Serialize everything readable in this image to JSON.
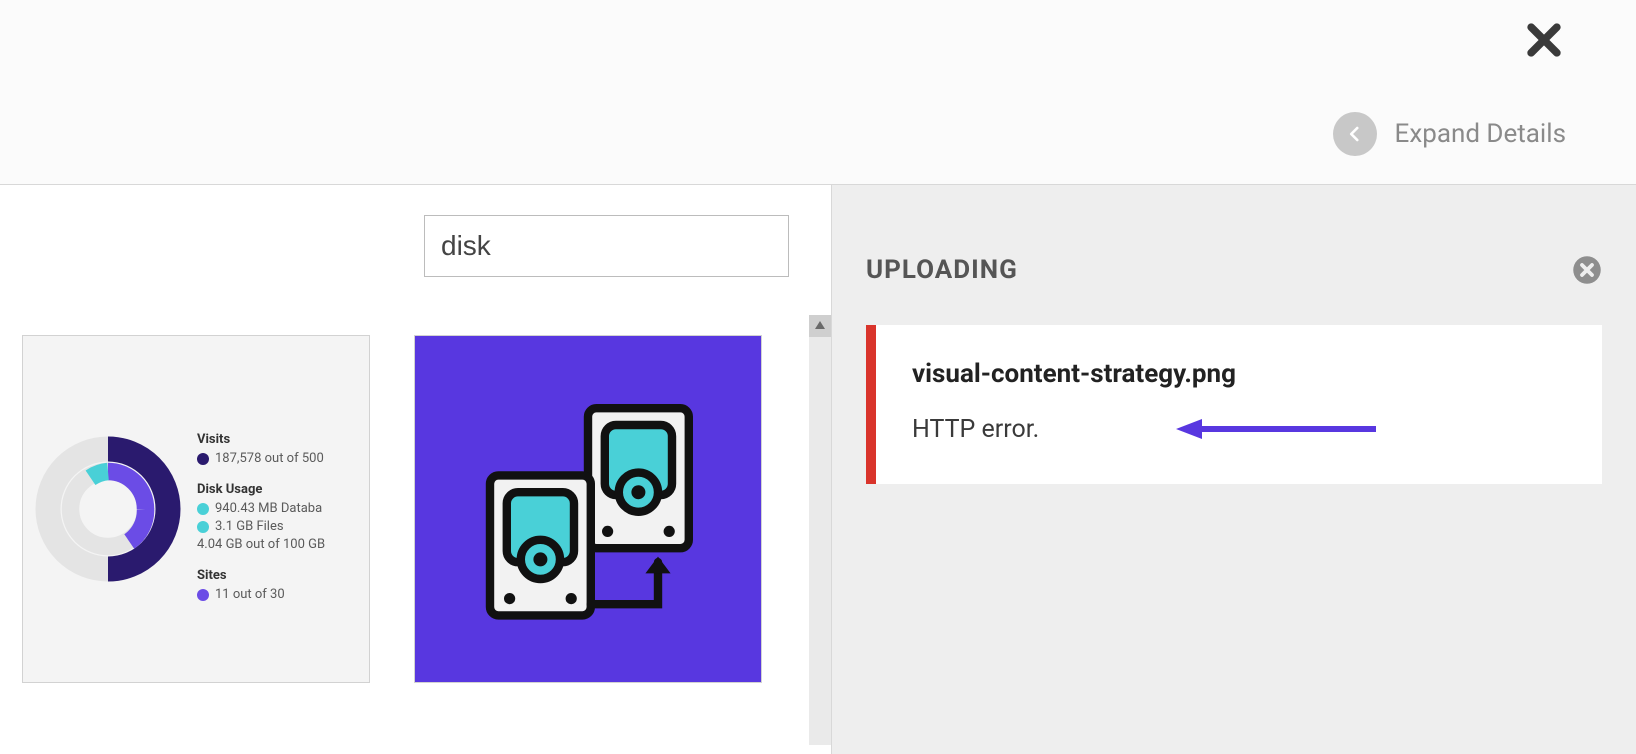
{
  "header": {
    "expand_label": "Expand Details"
  },
  "search": {
    "value": "disk"
  },
  "thumb1": {
    "visits_head": "Visits",
    "visits_line": "187,578 out of 500",
    "disk_head": "Disk Usage",
    "disk_line1": "940.43 MB Databa",
    "disk_line2": "3.1 GB Files",
    "disk_line3": "4.04 GB out of 100 GB",
    "sites_head": "Sites",
    "sites_line": "11 out of 30",
    "colors": {
      "navy": "#2a1a6e",
      "purple": "#6b4ce6",
      "teal": "#49d0d7",
      "grey": "#e4e4e4"
    }
  },
  "upload": {
    "section_title": "UPLOADING",
    "filename": "visual-content-strategy.png",
    "error": "HTTP error."
  }
}
